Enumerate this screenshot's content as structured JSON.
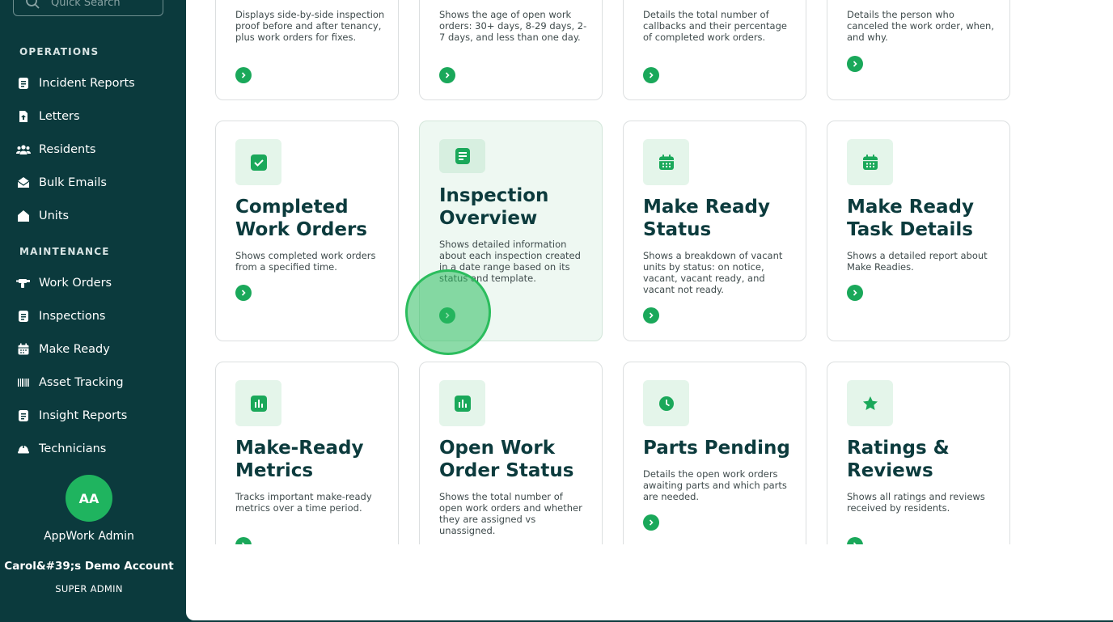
{
  "sidebar": {
    "search": {
      "placeholder": "Quick Search"
    },
    "sections": [
      {
        "title": "OPERATIONS"
      },
      {
        "title": "MAINTENANCE"
      }
    ],
    "operations": [
      {
        "label": "Incident Reports",
        "icon": "document-icon"
      },
      {
        "label": "Letters",
        "icon": "file-upload-icon"
      },
      {
        "label": "Residents",
        "icon": "people-icon"
      },
      {
        "label": "Bulk Emails",
        "icon": "mail-open-icon"
      },
      {
        "label": "Units",
        "icon": "home-icon"
      }
    ],
    "maintenance": [
      {
        "label": "Work Orders",
        "icon": "drill-icon"
      },
      {
        "label": "Inspections",
        "icon": "document-icon"
      },
      {
        "label": "Make Ready",
        "icon": "calendar-icon"
      },
      {
        "label": "Asset Tracking",
        "icon": "barcode-icon"
      },
      {
        "label": "Insight Reports",
        "icon": "document-icon"
      },
      {
        "label": "Technicians",
        "icon": "helmet-icon"
      }
    ],
    "user": {
      "initials": "AA",
      "name": "AppWork Admin",
      "account": "Carol&#39;s Demo Account",
      "role": "SUPER ADMIN"
    }
  },
  "cards_row1": [
    {
      "title": "",
      "desc": "Displays side-by-side inspection proof before and after tenancy, plus work orders for fixes."
    },
    {
      "title": "",
      "desc": "Shows the age of open work orders: 30+ days, 8-29 days, 2-7 days, and less than one day."
    },
    {
      "title": "",
      "desc": "Details the total number of callbacks and their percentage of completed work orders."
    },
    {
      "title": "",
      "desc": "Details the person who canceled the work order, when, and why."
    }
  ],
  "cards_row2": [
    {
      "title": "Completed Work Orders",
      "desc": "Shows completed work orders from a specified time.",
      "icon": "check-icon"
    },
    {
      "title": "Inspection Overview",
      "desc": "Shows detailed information about each inspection created in a date range based on its status and template.",
      "icon": "document-icon"
    },
    {
      "title": "Make Ready Status",
      "desc": "Shows a breakdown of vacant units by status: on notice, vacant, vacant ready, and vacant not ready.",
      "icon": "calendar-icon"
    },
    {
      "title": "Make Ready Task Details",
      "desc": "Shows a detailed report about Make Readies.",
      "icon": "calendar-icon"
    }
  ],
  "cards_row3": [
    {
      "title": "Make-Ready Metrics",
      "desc": "Tracks important make-ready metrics over a time period.",
      "icon": "bar-chart-icon"
    },
    {
      "title": "Open Work Order Status",
      "desc": "Shows the total number of open work orders and whether they are assigned vs unassigned.",
      "icon": "bar-chart-icon"
    },
    {
      "title": "Parts Pending",
      "desc": "Details the open work orders awaiting parts and which parts are needed.",
      "icon": "clock-icon"
    },
    {
      "title": "Ratings & Reviews",
      "desc": "Shows all ratings and reviews received by residents.",
      "icon": "star-icon"
    }
  ],
  "colors": {
    "sidebar_bg": "#0b3a3d",
    "accent": "#1aa85a",
    "tile_bg": "#e4f5ea",
    "title": "#0c3b3d"
  }
}
